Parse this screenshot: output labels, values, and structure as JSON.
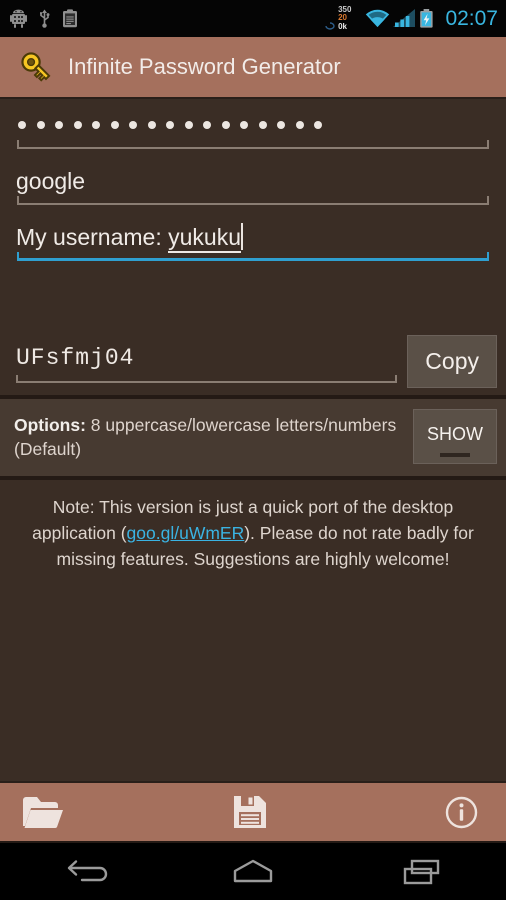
{
  "status_bar": {
    "left_icons": [
      "android-debug-icon",
      "usb-icon",
      "clipboard-icon"
    ],
    "network_down": "350",
    "network_mid": "20",
    "network_up": "0k",
    "right_icons": [
      "wifi-icon",
      "signal-icon",
      "battery-charging-icon"
    ],
    "time": "02:07",
    "accent_color": "#39b6e0"
  },
  "action_bar": {
    "icon": "key-icon",
    "title": "Infinite Password Generator",
    "background_color": "#a5705d"
  },
  "form": {
    "master_password": {
      "masked_dots": 17,
      "value": "•••••••••••••••••",
      "focused": false
    },
    "site": {
      "value": "google",
      "focused": false
    },
    "username": {
      "prefix": "My username: ",
      "composing": "yukuku",
      "value": "My username: yukuku",
      "focused": true,
      "focus_color": "#2f9fd0"
    },
    "generated": {
      "value": "UFsfmj04",
      "copy_label": "Copy"
    }
  },
  "options": {
    "label": "Options:",
    "value": " 8 uppercase/lowercase letters/numbers (Default)",
    "show_label": "SHOW"
  },
  "note": {
    "before_link": "Note: This version is just a quick port of the desktop application (",
    "link_text": "goo.gl/uWmER",
    "after_link": "). Please do not rate badly for missing features. Suggestions are highly welcome!",
    "link_color": "#3ab3e2"
  },
  "bottom_bar": {
    "items": [
      {
        "name": "open-folder-icon",
        "label": "Open"
      },
      {
        "name": "save-floppy-icon",
        "label": "Save"
      },
      {
        "name": "info-icon",
        "label": "Info"
      }
    ]
  },
  "nav_bar": {
    "items": [
      {
        "name": "back-nav-icon",
        "label": "Back"
      },
      {
        "name": "home-nav-icon",
        "label": "Home"
      },
      {
        "name": "recents-nav-icon",
        "label": "Recents"
      }
    ]
  }
}
